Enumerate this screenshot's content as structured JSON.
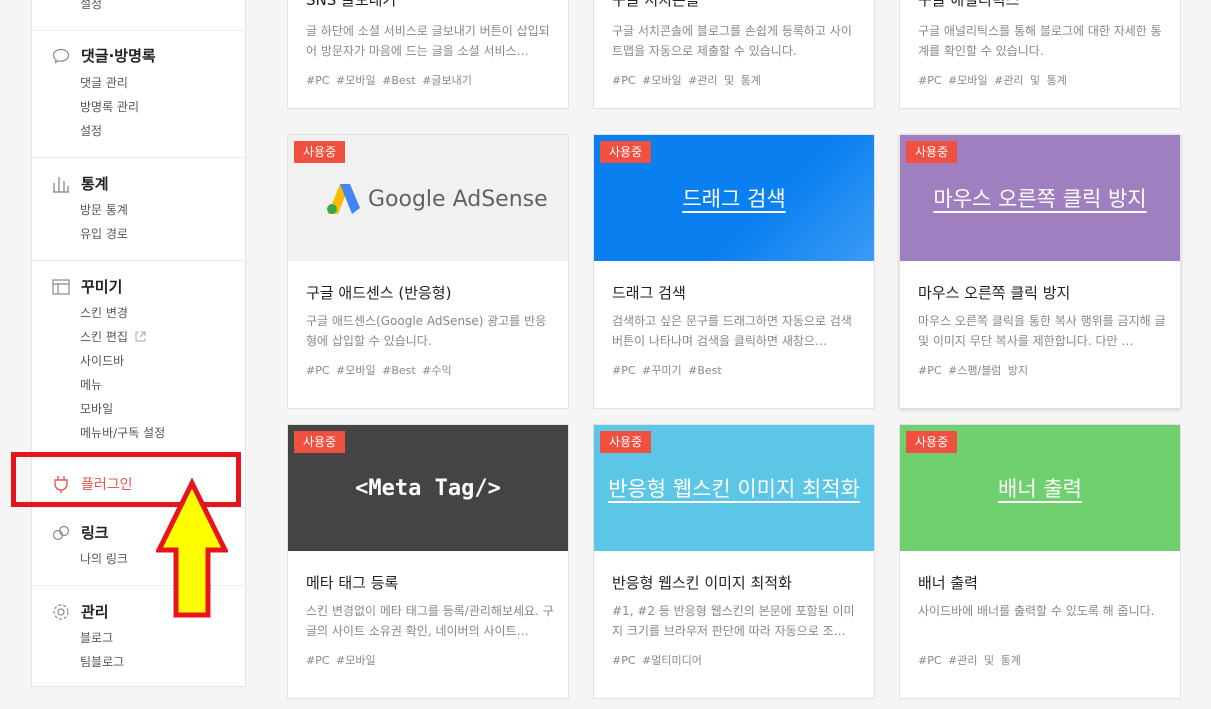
{
  "sidebar": {
    "top_item": "설정",
    "sections": [
      {
        "icon": "speech-bubble-icon",
        "title": "댓글·방명록",
        "items": [
          "댓글 관리",
          "방명록 관리",
          "설정"
        ]
      },
      {
        "icon": "bar-chart-icon",
        "title": "통계",
        "items": [
          "방문 통계",
          "유입 경로"
        ]
      },
      {
        "icon": "layout-icon",
        "title": "꾸미기",
        "items": [
          "스킨 변경",
          "스킨 편집",
          "사이드바",
          "메뉴",
          "모바일",
          "메뉴바/구독 설정"
        ]
      },
      {
        "icon": "plug-icon",
        "title": "플러그인",
        "items": []
      },
      {
        "icon": "link-icon",
        "title": "링크",
        "items": [
          "나의 링크"
        ]
      },
      {
        "icon": "gear-icon",
        "title": "관리",
        "items": [
          "블로그",
          "팀블로그"
        ]
      }
    ]
  },
  "colors": {
    "accent": "#e85a4f",
    "badge": "#f0503f",
    "highlight": "#e8141c",
    "arrow": "#ffff00"
  },
  "badge_label": "사용중",
  "cards_top": [
    {
      "title": "SNS 글보내기",
      "desc": "글 하단에 소셜 서비스로 글보내기 버튼이 삽입되어 방문자가 마음에 드는 글을 소셜 서비스…",
      "tags": "#PC #모바일 #Best #글보내기"
    },
    {
      "title": "구글 서치콘솔",
      "desc": "구글 서치콘솔에 블로그를 손쉽게 등록하고 사이트맵을 자동으로 제출할 수 있습니다.",
      "tags": "#PC #모바일 #관리 및 통계"
    },
    {
      "title": "구글 애널리틱스",
      "desc": "구글 애널리틱스를 통해 블로그에 대한 자세한 통계를 확인할 수 있습니다.",
      "tags": "#PC #모바일 #관리 및 통계"
    }
  ],
  "cards": [
    {
      "thumb": "Google AdSense",
      "title": "구글 애드센스 (반응형)",
      "desc": "구글 애드센스(Google AdSense) 광고를 반응형에 삽입할 수 있습니다.",
      "tags": "#PC #모바일 #Best #수익"
    },
    {
      "thumb": "드래그 검색",
      "title": "드래그 검색",
      "desc": "검색하고 싶은 문구를 드래그하면 자동으로 검색 버튼이 나타나며 검색을 클릭하면 새창으…",
      "tags": "#PC #꾸미기 #Best"
    },
    {
      "thumb": "마우스 오른쪽 클릭 방지",
      "title": "마우스 오른쪽 클릭 방지",
      "desc": "마우스 오른쪽 클릭을 통한 복사 행위를 금지해 글 및 이미지 무단 복사를 제한합니다. 다만 …",
      "tags": "#PC #스팸/블럼 방지"
    },
    {
      "thumb": "<Meta Tag/>",
      "title": "메타 태그 등록",
      "desc": "스킨 변경없이 메타 태그를 등록/관리해보세요. 구글의 사이트 소유권 확인, 네이버의 사이트…",
      "tags": "#PC #모바일"
    },
    {
      "thumb": "반응형 웹스킨 이미지 최적화",
      "title": "반응형 웹스킨 이미지 최적화",
      "desc": "#1, #2 등 반응형 웹스킨의 본문에 포함된 이미지 크기를 브라우저 판단에 따라 자동으로 조…",
      "tags": "#PC #멀티미디어"
    },
    {
      "thumb": "배너 출력",
      "title": "배너 출력",
      "desc": "사이드바에 배너를 출력할 수 있도록 해 줍니다.",
      "tags": "#PC #관리 및 통계"
    }
  ]
}
